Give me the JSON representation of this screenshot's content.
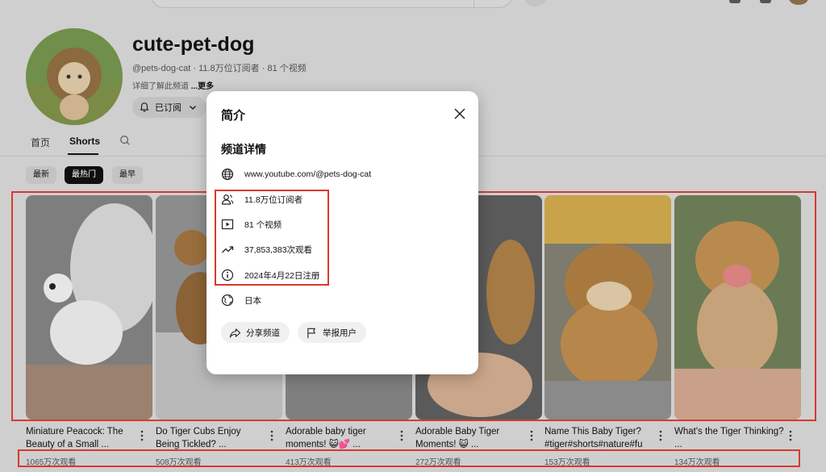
{
  "channel": {
    "name": "cute-pet-dog",
    "meta": "@pets-dog-cat · 11.8万位订阅者 · 81 个视频",
    "about_prefix": "详细了解此频道 ",
    "about_more": "...更多",
    "subscribe_label": "已订阅"
  },
  "tabs": [
    {
      "label": "首页"
    },
    {
      "label": "Shorts"
    }
  ],
  "chips": [
    {
      "label": "最新"
    },
    {
      "label": "最热门"
    },
    {
      "label": "最早"
    }
  ],
  "videos": [
    {
      "title": "Miniature Peacock: The Beauty of a Small ...",
      "views": "1065万次观看"
    },
    {
      "title": "Do Tiger Cubs Enjoy Being Tickled? ...",
      "views": "508万次观看"
    },
    {
      "title": "Adorable baby tiger moments! 😺💕 ...",
      "views": "413万次观看"
    },
    {
      "title": "Adorable Baby Tiger Moments! 😺 ...",
      "views": "272万次观看"
    },
    {
      "title": "Name This Baby Tiger? #tiger#shorts#nature#fu",
      "views": "153万次观看"
    },
    {
      "title": "What's the Tiger Thinking? ...",
      "views": "134万次观看"
    }
  ],
  "dialog": {
    "title": "简介",
    "section_title": "频道详情",
    "url": "www.youtube.com/@pets-dog-cat",
    "subscribers": "11.8万位订阅者",
    "videos": "81 个视频",
    "views": "37,853,383次观看",
    "joined": "2024年4月22日注册",
    "country": "日本",
    "share_label": "分享频道",
    "report_label": "举报用户"
  },
  "colors": {
    "annotation_red": "#d63a2c",
    "dim_overlay": "#cfcfcf",
    "dialog_bg": "#ffffff"
  },
  "icons": [
    "search-icon",
    "mic-icon",
    "bell-icon",
    "chevron-down-icon",
    "close-icon",
    "globe-icon",
    "person-icon",
    "play-icon",
    "trending-icon",
    "info-icon",
    "share-icon",
    "flag-icon",
    "more-vert-icon"
  ]
}
